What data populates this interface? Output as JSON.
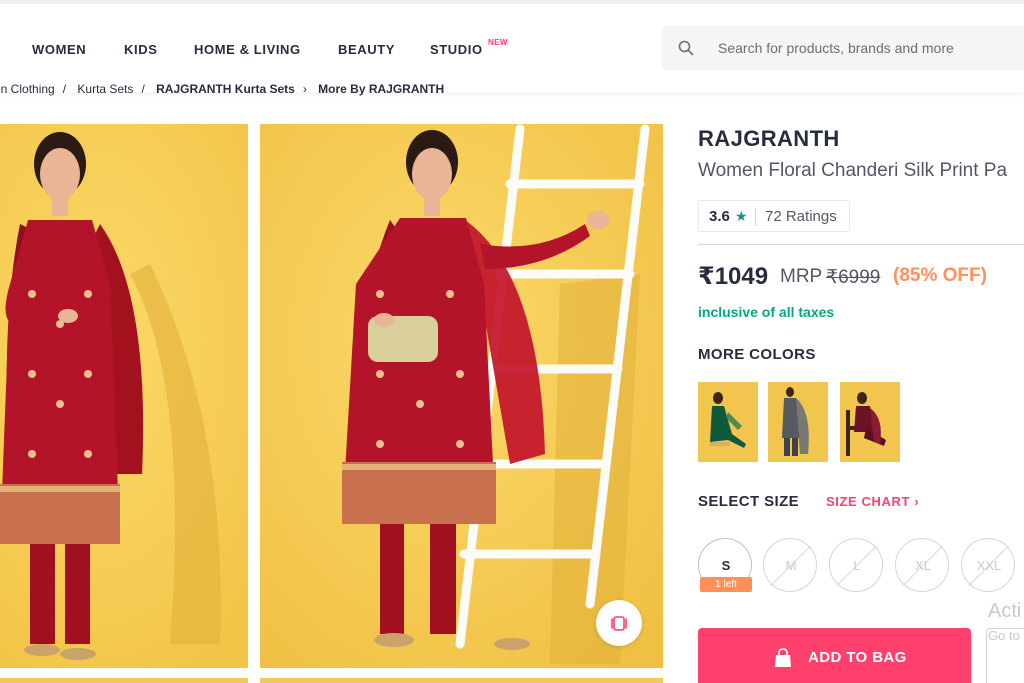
{
  "header": {
    "nav": [
      {
        "label": "WOMEN"
      },
      {
        "label": "KIDS"
      },
      {
        "label": "HOME & LIVING"
      },
      {
        "label": "BEAUTY"
      },
      {
        "label": "STUDIO",
        "badge": "NEW"
      }
    ],
    "search": {
      "placeholder": "Search for products, brands and more",
      "icon": "search-icon"
    }
  },
  "breadcrumb": [
    "en Clothing",
    "Kurta Sets",
    "RAJGRANTH Kurta Sets",
    "More By RAJGRANTH"
  ],
  "product": {
    "brand": "RAJGRANTH",
    "name": "Women Floral Chanderi Silk Print Pa",
    "rating": {
      "value": "3.6",
      "star": "★",
      "count": "72 Ratings"
    },
    "price": "₹1049",
    "mrp_label": "MRP",
    "mrp": "₹6999",
    "discount": "(85% OFF)",
    "taxes_note": "inclusive of all taxes",
    "more_colors_label": "MORE COLORS",
    "select_size_label": "SELECT SIZE",
    "size_chart_label": "SIZE CHART ›",
    "sizes": [
      {
        "label": "S",
        "available": true,
        "note": "1 left"
      },
      {
        "label": "M",
        "available": false
      },
      {
        "label": "L",
        "available": false
      },
      {
        "label": "XL",
        "available": false
      },
      {
        "label": "XXL",
        "available": false
      }
    ],
    "add_to_bag": "ADD TO BAG"
  },
  "overlay": {
    "activate": "Acti",
    "goto": "Go to"
  },
  "colors": {
    "accent": "#ff3f6c",
    "discount": "#ff905a",
    "taxes": "#03a685",
    "image_bg": "#f6cd55",
    "kurta": "#b3142a"
  }
}
